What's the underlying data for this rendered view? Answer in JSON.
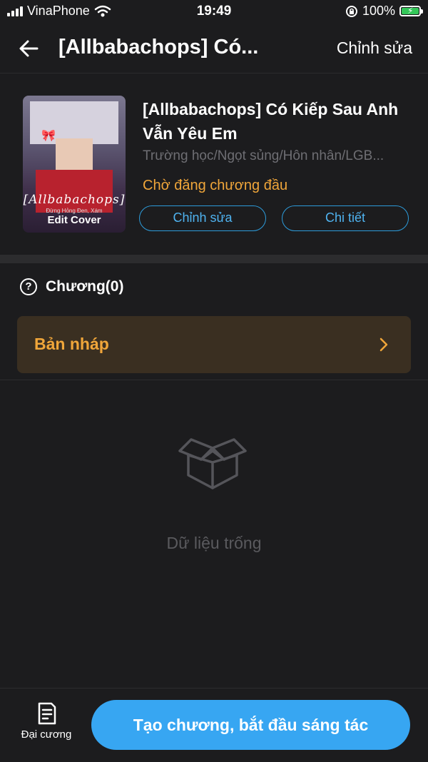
{
  "status_bar": {
    "carrier": "VinaPhone",
    "time": "19:49",
    "battery_percent": "100%",
    "battery_level": 1.0,
    "icons": [
      "signal-icon",
      "wifi-icon",
      "orientation-lock-icon",
      "battery-charging-icon"
    ]
  },
  "nav": {
    "title": "[Allbabachops] Có...",
    "edit_label": "Chỉnh sửa",
    "back_icon": "back-arrow-icon"
  },
  "book": {
    "cover_title": "[Allbabachops]",
    "cover_subtitle": "Đừng Hỏng Đen, Xám",
    "cover_edit_label": "Edit Cover",
    "title": "[Allbabachops] Có Kiếp Sau Anh Vẫn Yêu Em",
    "tags": "Trường học/Ngọt sủng/Hôn nhân/LGB...",
    "status": "Chờ đăng chương đầu",
    "edit_button": "Chỉnh sửa",
    "detail_button": "Chi tiết"
  },
  "chapters": {
    "label": "Chương(0)",
    "help_icon": "question-circle-icon",
    "draft_label": "Bản nháp",
    "draft_icon": "chevron-right-icon",
    "empty_icon": "empty-box-icon",
    "empty_text": "Dữ liệu trống"
  },
  "bottom": {
    "outline_label": "Đại cương",
    "outline_icon": "document-icon",
    "create_button": "Tạo chương, bắt đầu sáng tác"
  },
  "colors": {
    "background": "#1c1c1e",
    "accent_blue": "#37a6f2",
    "accent_orange": "#f0a63a",
    "draft_bg": "#3a2f21"
  }
}
